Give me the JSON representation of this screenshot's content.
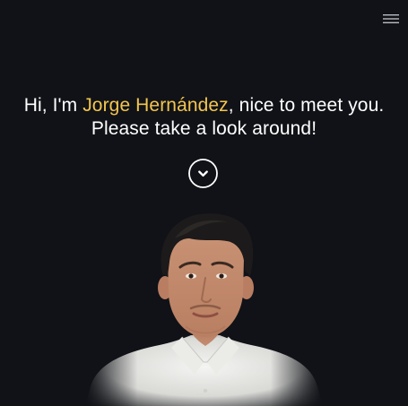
{
  "hero": {
    "greeting_prefix": "Hi, I'm ",
    "name": "Jorge Hernández",
    "greeting_suffix": ", nice to meet you.",
    "line_two": "Please take a look around!"
  },
  "icons": {
    "menu": "hamburger-menu-icon",
    "scroll": "chevron-down-circle-icon"
  },
  "colors": {
    "background": "#101217",
    "accent": "#f3c54f",
    "text": "#ffffff"
  }
}
